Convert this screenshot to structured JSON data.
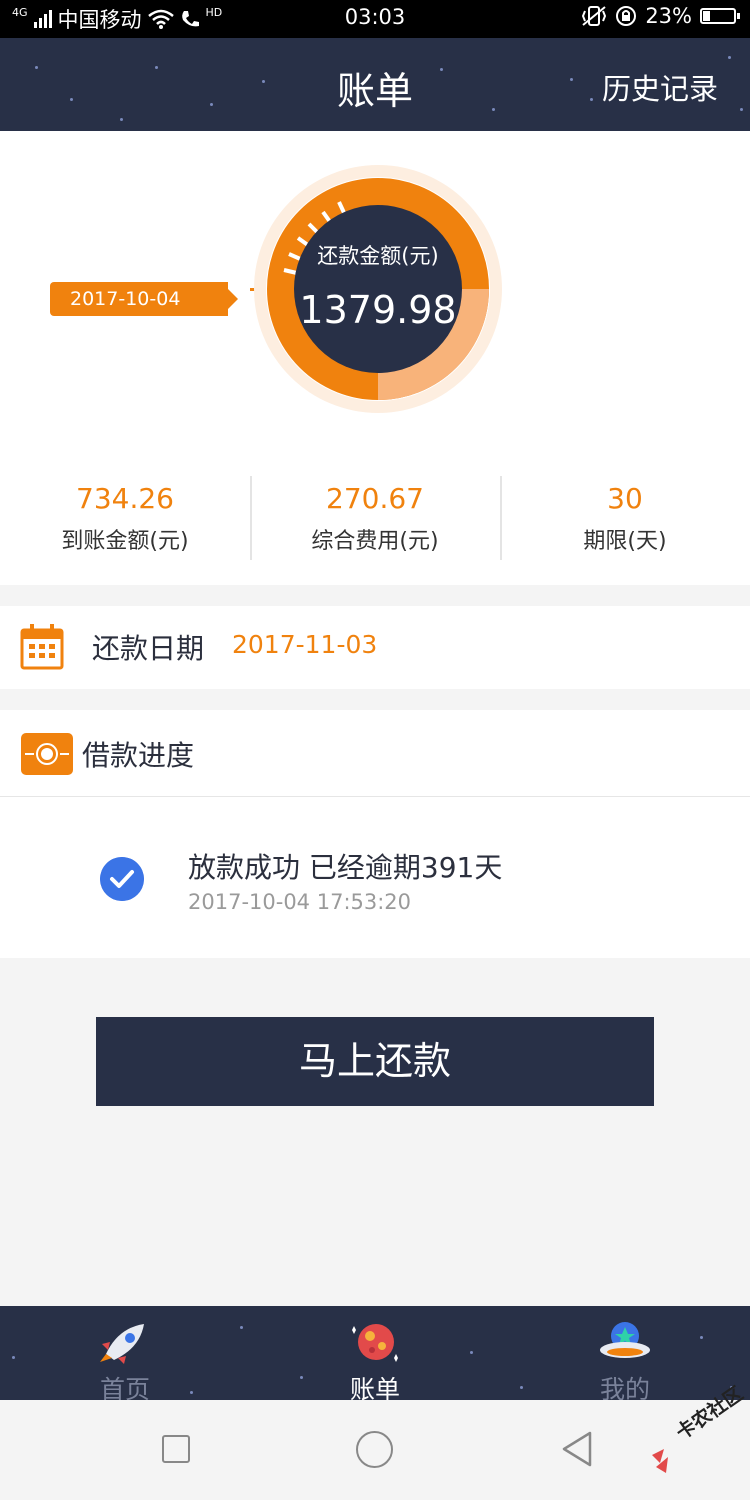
{
  "status_bar": {
    "network": "4G",
    "carrier": "中国移动",
    "hd": "HD",
    "time": "03:03",
    "battery": "23%",
    "battery_level": 0.23
  },
  "header": {
    "title": "账单",
    "history_link": "历史记录"
  },
  "bill": {
    "date_tag": "2017-10-04",
    "ring_label": "还款金额(元)",
    "amount": "1379.98",
    "stats": [
      {
        "value": "734.26",
        "label": "到账金额(元)"
      },
      {
        "value": "270.67",
        "label": "综合费用(元)"
      },
      {
        "value": "30",
        "label": "期限(天)"
      }
    ]
  },
  "repayment": {
    "label": "还款日期",
    "date": "2017-11-03"
  },
  "progress": {
    "title": "借款进度",
    "step_title": "放款成功 已经逾期391天",
    "step_time": "2017-10-04 17:53:20"
  },
  "actions": {
    "pay_now": "马上还款"
  },
  "tabbar": {
    "items": [
      {
        "label": "首页",
        "icon": "rocket-icon",
        "active": false
      },
      {
        "label": "账单",
        "icon": "planet-icon",
        "active": true
      },
      {
        "label": "我的",
        "icon": "ufo-icon",
        "active": false
      }
    ]
  },
  "watermark": {
    "text": "卡农社区"
  },
  "colors": {
    "accent": "#f0820e",
    "navy": "#283047",
    "check": "#3b74e6"
  }
}
